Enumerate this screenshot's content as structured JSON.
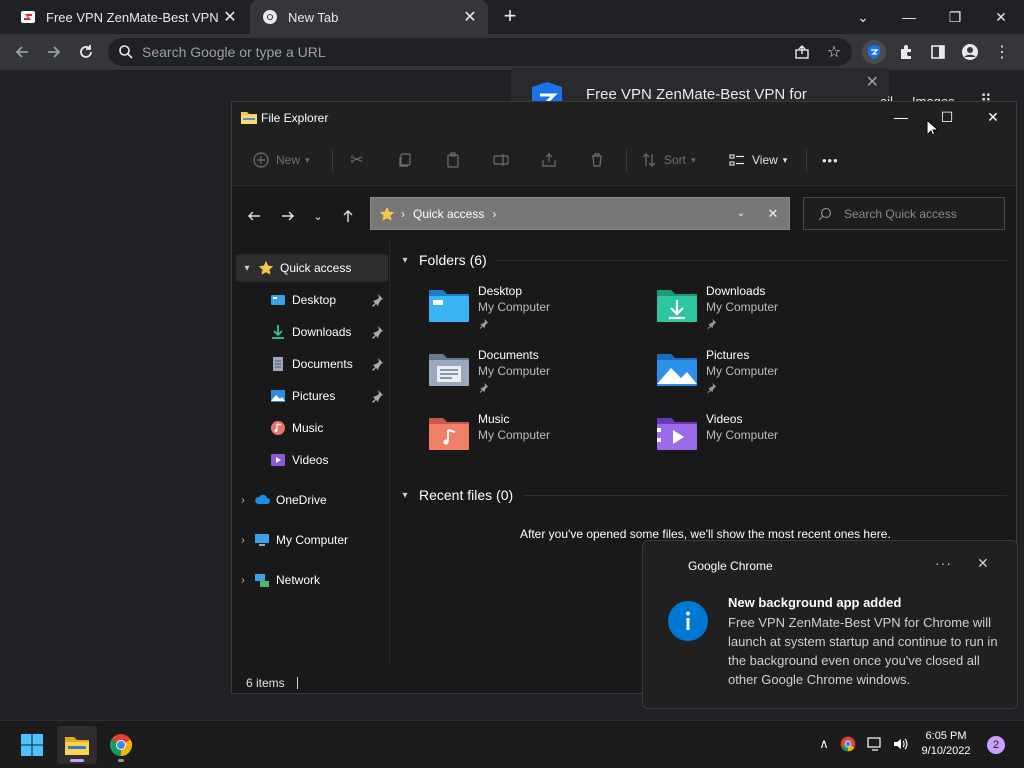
{
  "chrome": {
    "tabs": [
      {
        "title": "Free VPN ZenMate-Best VPN for",
        "close": "✕"
      },
      {
        "title": "New Tab",
        "close": "✕"
      }
    ],
    "new_tab": "+",
    "window_controls": {
      "tab_search": "⌄",
      "minimize": "—",
      "restore": "❐",
      "close": "✕"
    },
    "omnibox_placeholder": "Search Google or type a URL"
  },
  "extension_popup": {
    "title": "Free VPN ZenMate-Best VPN for",
    "close": "✕",
    "behind_links": [
      "ail",
      "Images"
    ]
  },
  "explorer": {
    "title": "File Explorer",
    "window_controls": {
      "minimize": "—",
      "maximize": "☐",
      "close": "✕"
    },
    "commands": {
      "new": "New",
      "sort": "Sort",
      "view": "View",
      "more": "•••"
    },
    "address": {
      "location": "Quick access"
    },
    "search_placeholder": "Search Quick access",
    "nav": {
      "quick_access": "Quick access",
      "pinned": [
        {
          "label": "Desktop",
          "icon": "desktop-icon"
        },
        {
          "label": "Downloads",
          "icon": "downloads-icon"
        },
        {
          "label": "Documents",
          "icon": "documents-icon"
        },
        {
          "label": "Pictures",
          "icon": "pictures-icon"
        }
      ],
      "other": [
        {
          "label": "Music",
          "icon": "music-icon"
        },
        {
          "label": "Videos",
          "icon": "videos-icon"
        }
      ],
      "roots": [
        "OneDrive",
        "My Computer",
        "Network"
      ]
    },
    "folders_header": "Folders (6)",
    "folders": [
      {
        "name": "Desktop",
        "location": "My Computer",
        "pinned": true
      },
      {
        "name": "Downloads",
        "location": "My Computer",
        "pinned": true
      },
      {
        "name": "Documents",
        "location": "My Computer",
        "pinned": true
      },
      {
        "name": "Pictures",
        "location": "My Computer",
        "pinned": true
      },
      {
        "name": "Music",
        "location": "My Computer",
        "pinned": false
      },
      {
        "name": "Videos",
        "location": "My Computer",
        "pinned": false
      }
    ],
    "recent_header": "Recent files (0)",
    "recent_empty": "After you've opened some files, we'll show the most recent ones here.",
    "status": "6 items"
  },
  "toast": {
    "app": "Google Chrome",
    "more": "···",
    "close": "✕",
    "title": "New background app added",
    "body": "Free VPN ZenMate-Best VPN for Chrome will launch at system startup and continue to run in the background even once you've closed all other Google Chrome windows."
  },
  "taskbar": {
    "time": "6:05 PM",
    "date": "9/10/2022",
    "notifications": "2"
  },
  "colors": {
    "chrome_bg": "#202124",
    "chrome_toolbar": "#35363a",
    "explorer_bg": "#191919",
    "address_bar": "#777777",
    "accent_blue": "#0078d4",
    "folder_yellow": "#f4c84a",
    "zenmate_blue": "#1a73e8"
  }
}
